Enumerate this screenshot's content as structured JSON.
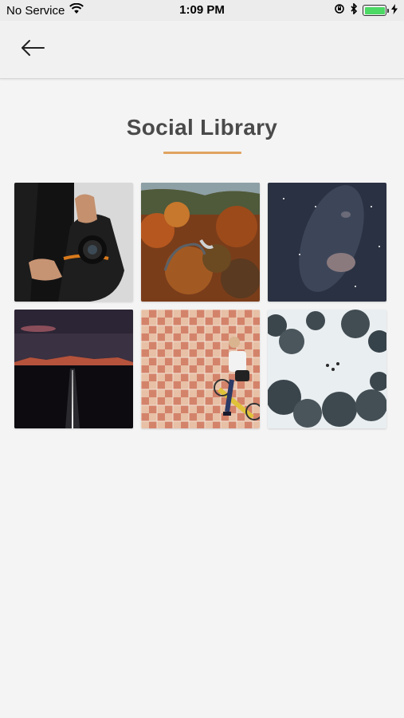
{
  "status_bar": {
    "carrier": "No Service",
    "time": "1:09 PM",
    "battery_level": 1.0
  },
  "nav": {
    "back_icon": "arrow-left-icon"
  },
  "page": {
    "title": "Social Library",
    "accent_color": "#e0a360"
  },
  "photos": [
    {
      "subject": "camera-bag-photo"
    },
    {
      "subject": "autumn-forest-road-photo"
    },
    {
      "subject": "night-sky-photo"
    },
    {
      "subject": "dusk-road-mountains-photo"
    },
    {
      "subject": "cyclist-tiled-plaza-photo"
    },
    {
      "subject": "snowy-forest-photo"
    }
  ]
}
